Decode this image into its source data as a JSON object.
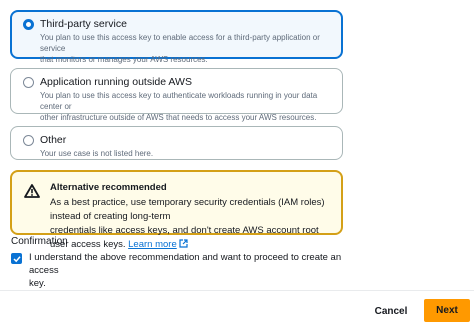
{
  "options": [
    {
      "title": "Third-party service",
      "description_line1": "You plan to use this access key to enable access for a third-party application or service",
      "description_line2": "that monitors or manages your AWS resources.",
      "selected": true
    },
    {
      "title": "Application running outside AWS",
      "description_line1": "You plan to use this access key to authenticate workloads running in your data center or",
      "description_line2": "other infrastructure outside of AWS that needs to access your AWS resources.",
      "selected": false
    },
    {
      "title": "Other",
      "description_line1": "Your use case is not listed here.",
      "selected": false
    }
  ],
  "alert": {
    "title": "Alternative recommended",
    "body_line1": "As a best practice, use temporary security credentials (IAM roles) instead of creating long-term",
    "body_line2": "credentials like access keys, and don't create AWS account root user access keys.",
    "link_text": "Learn more",
    "icon": "warning-icon"
  },
  "confirmation": {
    "label": "Confirmation",
    "checkbox_text_line1": "I understand the above recommendation and want to proceed to create an access",
    "checkbox_text_line2": "key.",
    "checked": true
  },
  "footer": {
    "cancel_label": "Cancel",
    "next_label": "Next"
  },
  "colors": {
    "accent": "#0972d3",
    "warning": "#d4a017",
    "primary_button": "#ff9900"
  }
}
